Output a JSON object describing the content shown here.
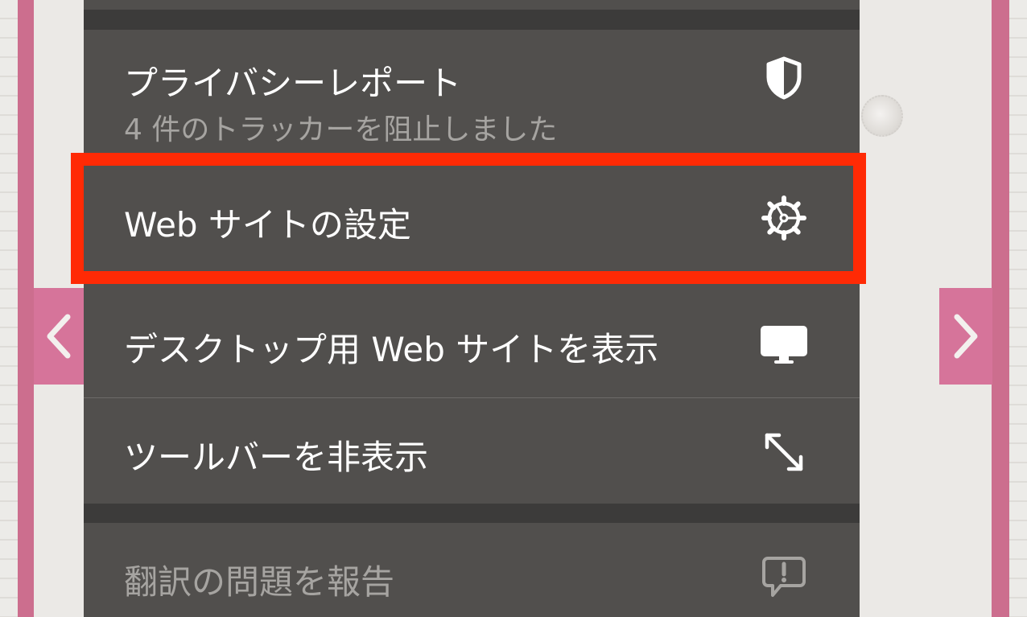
{
  "menu": {
    "privacy_report": {
      "label": "プライバシーレポート",
      "sublabel": "4 件のトラッカーを阻止しました",
      "icon": "shield-icon"
    },
    "website_settings": {
      "label": "Web サイトの設定",
      "icon": "gear-icon"
    },
    "desktop_site": {
      "label": "デスクトップ用 Web サイトを表示",
      "icon": "monitor-icon"
    },
    "hide_toolbar": {
      "label": "ツールバーを非表示",
      "icon": "expand-arrows-icon"
    },
    "report_translation": {
      "label": "翻訳の問題を報告",
      "icon": "report-bubble-icon"
    }
  },
  "colors": {
    "highlight": "#ff2a05",
    "menu_item_bg": "#514f4d",
    "menu_bg": "#3c3b3a",
    "accent_pink": "#d6749a"
  }
}
